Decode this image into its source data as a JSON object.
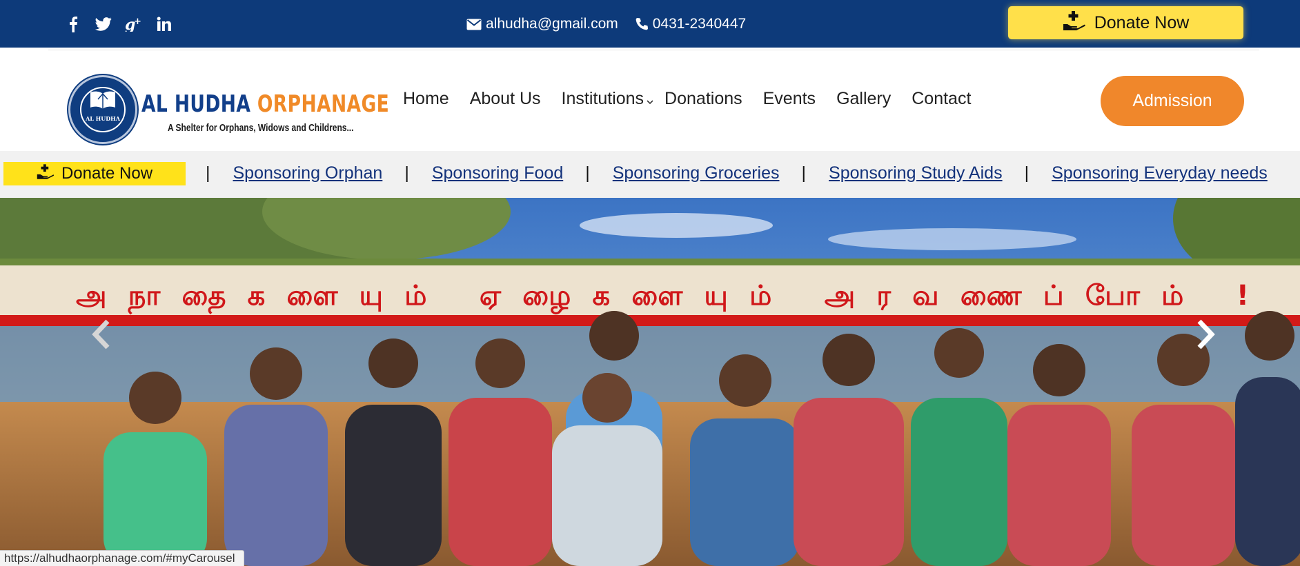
{
  "topbar": {
    "social": [
      {
        "name": "facebook-icon",
        "glyph": "f"
      },
      {
        "name": "twitter-icon",
        "glyph": "t"
      },
      {
        "name": "google-plus-icon",
        "glyph": "g+"
      },
      {
        "name": "linkedin-icon",
        "glyph": "in"
      }
    ],
    "email": "alhudha@gmail.com",
    "phone": "0431-2340447",
    "donate_label": "Donate Now",
    "bg_color": "#0d3a7a",
    "donate_color": "#ffe04a"
  },
  "header": {
    "logo_name_part1": "AL HUDHA",
    "logo_name_part2": "ORPHANAGE",
    "tagline": "A Shelter for Orphans, Widows and Childrens...",
    "emblem_text": "AL HUDHA",
    "nav": [
      "Home",
      "About Us",
      "Institutions",
      "Donations",
      "Events",
      "Gallery",
      "Contact"
    ],
    "admission_label": "Admission",
    "brand_blue": "#123f8a",
    "brand_orange": "#f08a28"
  },
  "strip": {
    "donate_label": "Donate Now",
    "separator": "|",
    "links": [
      "Sponsoring Orphan",
      "Sponsoring Food",
      "Sponsoring Groceries",
      "Sponsoring Study Aids",
      "Sponsoring Everyday needs"
    ],
    "link_color": "#13327b"
  },
  "carousel": {
    "banner_text": "அநாதைகளையும் ஏழைகளையும் அரவணைப்போம் !",
    "prev_icon": "chevron-left-icon",
    "next_icon": "chevron-right-icon"
  },
  "status_bar": {
    "url": "https://alhudhaorphanage.com/#myCarousel"
  }
}
